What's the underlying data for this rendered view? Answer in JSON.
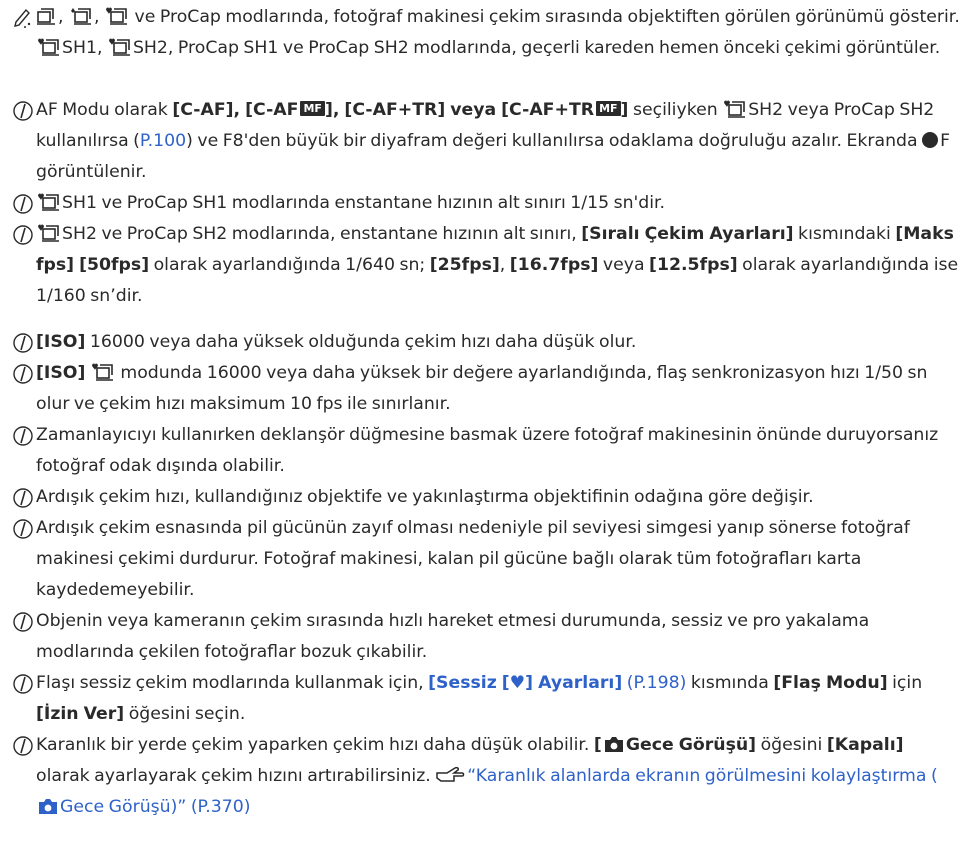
{
  "colors": {
    "text": "#2a2a2a",
    "link": "#2f62c9"
  },
  "icons": {
    "note": "pencil-note-icon",
    "tip": "tip-icon",
    "drive": "sequential-drive-icon",
    "camera": "camera-icon",
    "pointer": "pointing-hand-icon"
  },
  "notes": [
    {
      "p1": ", ",
      "p2": ", ",
      "p3": " ve ProCap modlarında, fotoğraf makinesi çekim sırasında objektiften görülen görünümü gösterir. ",
      "p4": "SH1, ",
      "p5": "SH2, ProCap SH1 ve ProCap SH2 modlarında, geçerli kareden hemen önceki çekimi görüntüler."
    },
    {
      "p1": "AF Modu olarak ",
      "b1": "[C-AF], [C-AF",
      "mf1": "MF",
      "b2": "], [C-AF+TR] veya [C-AF+TR",
      "mf2": "MF",
      "b3": "]",
      "p2": " seçiliyken ",
      "p3": "SH2 veya ProCap SH2 kullanılırsa (",
      "link1": "P.100",
      "p4": ") ve F8'den büyük bir diyafram değeri kullanılırsa odaklama doğruluğu azalır. Ekranda ",
      "p5": "F görüntülenir."
    },
    {
      "p1": "SH1 ve ProCap SH1 modlarında enstantane hızının alt sınırı 1/15 sn'dir."
    },
    {
      "p1": "SH2 ve ProCap SH2 modlarında, enstantane hızının alt sınırı, ",
      "b1": "[Sıralı Çekim Ayarları]",
      "p2": " kısmındaki ",
      "b2": "[Maks fps] [50fps]",
      "p3": " olarak ayarlandığında 1/640 sn; ",
      "b3": "[25fps]",
      "p4": ", ",
      "b4": "[16.7fps]",
      "p5": " veya ",
      "b5": "[12.5fps]",
      "p6": " olarak ayarlandığında ise 1/160 sn’dir."
    },
    {
      "b1": "[ISO]",
      "p1": " 16000 veya daha yüksek olduğunda çekim hızı daha düşük olur."
    },
    {
      "b1": "[ISO]",
      "p1": " modunda 16000 veya daha yüksek bir değere ayarlandığında, flaş senkronizasyon hızı 1/50 sn olur ve çekim hızı maksimum 10 fps ile sınırlanır."
    },
    {
      "p1": "Zamanlayıcıyı kullanırken deklanşör düğmesine basmak üzere fotoğraf makinesinin önünde duruyorsanız fotoğraf odak dışında olabilir."
    },
    {
      "p1": "Ardışık çekim hızı, kullandığınız objektife ve yakınlaştırma objektifinin odağına göre değişir."
    },
    {
      "p1": "Ardışık çekim esnasında pil gücünün zayıf olması nedeniyle pil seviyesi simgesi yanıp sönerse fotoğraf makinesi çekimi durdurur. Fotoğraf makinesi, kalan pil gücüne bağlı olarak tüm fotoğrafları karta kaydedemeyebilir."
    },
    {
      "p1": "Objenin veya kameranın çekim sırasında hızlı hareket etmesi durumunda, sessiz ve pro yakalama modlarında çekilen fotoğraflar bozuk çıkabilir."
    },
    {
      "p1": "Flaşı sessiz çekim modlarında kullanmak için, ",
      "link1": "[Sessiz [♥] Ayarları]",
      "link2": " (P.198)",
      "p2": " kısmında ",
      "b1": "[Flaş Modu]",
      "p3": " için ",
      "b2": "[İzin Ver]",
      "p4": " öğesini seçin."
    },
    {
      "p1": "Karanlık bir yerde çekim yaparken çekim hızı daha düşük olabilir. ",
      "b1": "[",
      "b2": "Gece Görüşü]",
      "p2": " öğesini ",
      "b3": "[Kapalı]",
      "p3": " olarak ayarlayarak çekim hızını artırabilirsiniz. ",
      "link1": "“Karanlık alanlarda ekranın görülmesini kolaylaştırma (",
      "link2": "Gece Görüşü)” (P.370)"
    }
  ]
}
